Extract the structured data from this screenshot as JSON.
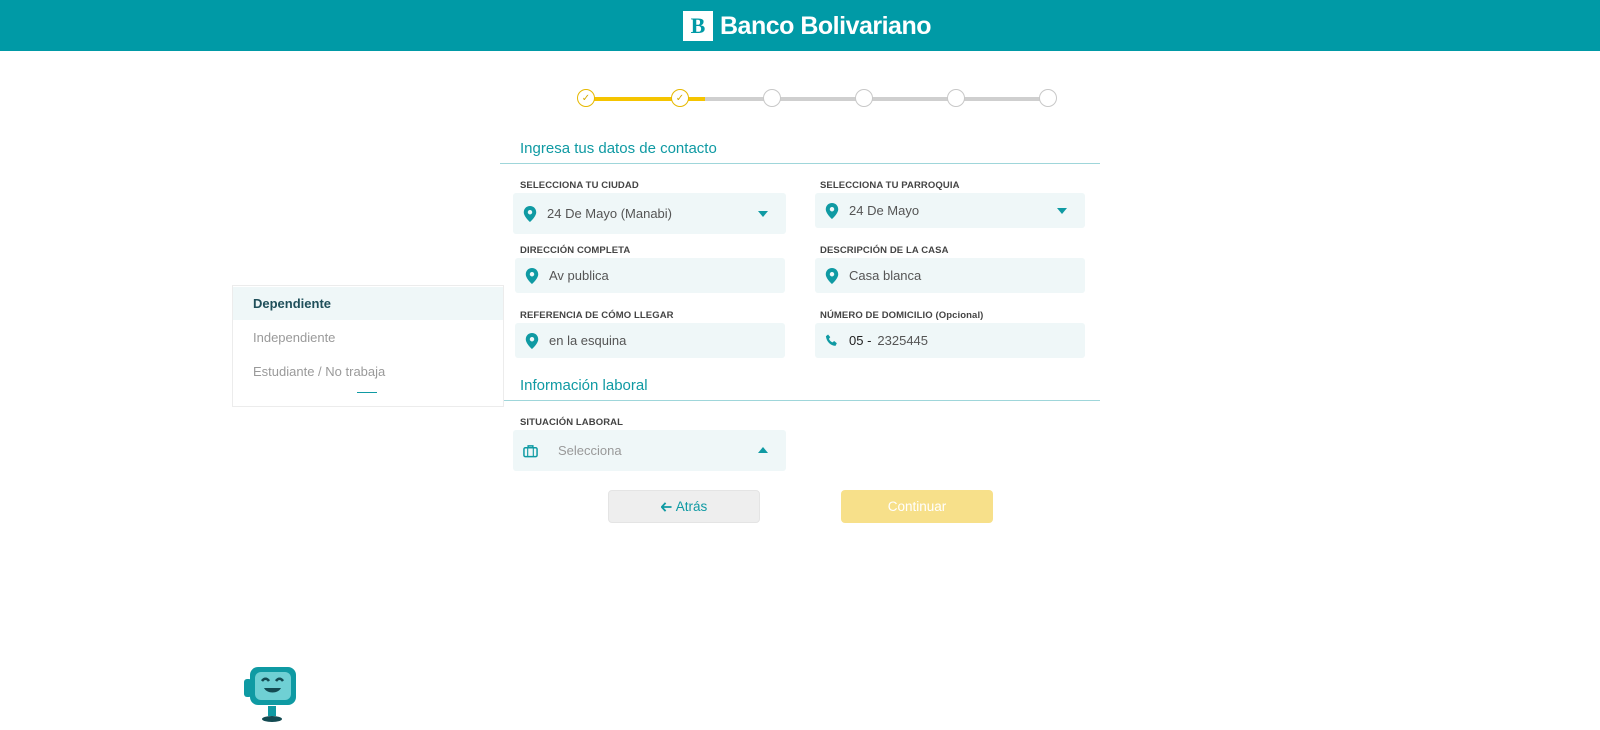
{
  "header": {
    "logo_mark": "B",
    "brand": "Banco Bolivariano"
  },
  "stepper": {
    "steps": [
      "done",
      "done",
      "todo",
      "todo",
      "todo",
      "todo"
    ],
    "progress_fraction": 0.27
  },
  "contact": {
    "title": "Ingresa tus datos de contacto",
    "city": {
      "label": "SELECCIONA TU CIUDAD",
      "value": "24 De Mayo (Manabi)"
    },
    "parish": {
      "label": "SELECCIONA TU PARROQUIA",
      "value": "24 De Mayo"
    },
    "address": {
      "label": "DIRECCIÓN COMPLETA",
      "value": "Av publica"
    },
    "house": {
      "label": "DESCRIPCIÓN DE LA CASA",
      "value": "Casa blanca"
    },
    "reference": {
      "label": "REFERENCIA DE CÓMO LLEGAR",
      "value": "en la esquina"
    },
    "phone": {
      "label": "NÚMERO DE DOMICILIO (Opcional)",
      "prefix": "05 -",
      "value": "2325445"
    }
  },
  "work": {
    "title": "Información laboral",
    "situation": {
      "label": "SITUACIÓN LABORAL",
      "placeholder": "Selecciona"
    },
    "options": [
      "Dependiente",
      "Independiente",
      "Estudiante / No trabaja"
    ]
  },
  "actions": {
    "back_label": "Atrás",
    "back_icon": "arrow-left-icon",
    "continue_label": "Continuar"
  },
  "colors": {
    "header": "#009aa6",
    "accent": "#0f9aa3",
    "progress": "#f5c400",
    "continue_disabled": "#f7e08a"
  }
}
